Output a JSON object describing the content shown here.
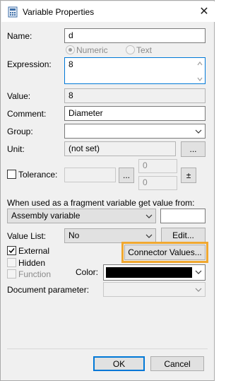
{
  "window": {
    "title": "Variable Properties",
    "close_glyph": "✕"
  },
  "fields": {
    "name_label": "Name:",
    "name_value": "d",
    "numeric_label": "Numeric",
    "text_label": "Text",
    "expression_label": "Expression:",
    "expression_value": "8",
    "value_label": "Value:",
    "value_value": "8",
    "comment_label": "Comment:",
    "comment_value": "Diameter",
    "group_label": "Group:",
    "group_value": "",
    "unit_label": "Unit:",
    "unit_value": "(not set)",
    "unit_button": "...",
    "tolerance_label": "Tolerance:",
    "tolerance_button": "...",
    "tolerance_upper": "0",
    "tolerance_lower": "0",
    "plusminus_button": "±"
  },
  "fragment": {
    "label": "When used as a fragment variable get value from:",
    "source_value": "Assembly variable",
    "source_extra": ""
  },
  "valuelist": {
    "label": "Value List:",
    "value": "No",
    "edit_button": "Edit..."
  },
  "options": {
    "external_label": "External",
    "external_checked": true,
    "hidden_label": "Hidden",
    "hidden_checked": false,
    "function_label": "Function",
    "function_checked": false,
    "connector_button": "Connector Values...",
    "color_label": "Color:",
    "color_value": "#000000",
    "docparam_label": "Document parameter:",
    "docparam_value": ""
  },
  "footer": {
    "ok_button": "OK",
    "cancel_button": "Cancel"
  },
  "colors": {
    "highlight": "#f0a830",
    "primary_border": "#0078d7"
  },
  "icons": {
    "app": "calculator-icon",
    "close": "close-icon",
    "dropdown": "chevron-down-icon",
    "scroll_up": "scroll-up-arrow-icon",
    "scroll_down": "scroll-down-arrow-icon",
    "check": "checkmark-icon"
  }
}
